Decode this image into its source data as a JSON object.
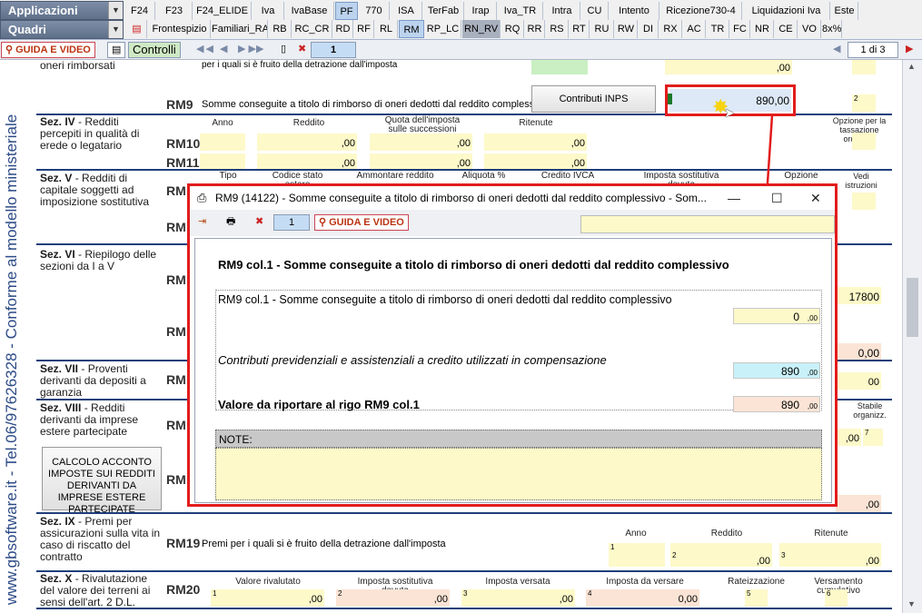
{
  "topbar": {
    "combo1": "Applicazioni",
    "combo2": "Quadri",
    "row1": [
      "F24",
      "F23",
      "F24_ELIDE",
      "Iva",
      "IvaBase",
      "PF",
      "770",
      "ISA",
      "TerFab",
      "Irap",
      "Iva_TR",
      "Intra",
      "CU",
      "Intento",
      "Ricezione730-4",
      "Liquidazioni Iva",
      "Este"
    ],
    "row2": [
      "Frontespizio",
      "Familiari_RA",
      "RB",
      "RC_CR",
      "RD",
      "RF",
      "RL",
      "RM",
      "RP_LC",
      "RN_RV",
      "RQ",
      "RR",
      "RS",
      "RT",
      "RU",
      "RW",
      "DI",
      "RX",
      "AC",
      "TR",
      "FC",
      "NR",
      "CE",
      "VO",
      "8x%"
    ]
  },
  "toolbar": {
    "guida": "GUIDA E VIDEO",
    "controlli": "Controlli",
    "page": "1",
    "pager": "1 di 3"
  },
  "sidebar": {
    "vertical": "www.gbsoftware.it - Tel.06/97626328 - Conforme al modello ministeriale"
  },
  "form": {
    "top_text1": "oneri rimborsati",
    "top_text2": "per i quali si è fruito della detrazione dall'imposta",
    "top_val": ",00",
    "rm9": {
      "label": "RM9",
      "desc": "Somme conseguite a titolo di rimborso di oneri dedotti dal reddito complessivo",
      "button": "Contributi INPS",
      "value": "890",
      "dec": ",00",
      "col2": "2"
    },
    "sez4": {
      "title": "Sez. IV",
      "sub": "- Redditi percepiti in qualità di erede o legatario",
      "h": [
        "Anno",
        "Reddito",
        "Quota dell'imposta sulle successioni",
        "Ritenute",
        "Opzione per la tassazione ordinaria"
      ],
      "rows": [
        "RM10",
        "RM11"
      ]
    },
    "sez5": {
      "title": "Sez. V",
      "sub": "- Redditi di capitale soggetti ad imposizione sostitutiva",
      "h": [
        "Tipo",
        "Codice stato estero",
        "Ammontare reddito",
        "Aliquota %",
        "Credito IVCA",
        "Imposta sostitutiva dovuta",
        "Opzione",
        "Vedi istruzioni"
      ],
      "rows": [
        "RM",
        "RM"
      ]
    },
    "sez6": {
      "title": "Sez. VI",
      "sub": "- Riepilogo delle sezioni da I a V",
      "rows": [
        "RM",
        "RM"
      ],
      "val": "178",
      "val2": "0"
    },
    "sez7": {
      "title": "Sez. VII",
      "sub": "- Proventi derivanti da depositi a garanzia",
      "rows": [
        "RM"
      ]
    },
    "sez8": {
      "title": "Sez. VIII",
      "sub": "- Redditi derivanti da imprese estere partecipate",
      "rows": [
        "RM",
        "RM"
      ],
      "stabile": "Stabile organizz.",
      "btn": "CALCOLO ACCONTO IMPOSTE SUI REDDITI DERIVANTI DA IMPRESE ESTERE PARTECIPATE"
    },
    "sez9": {
      "title": "Sez. IX",
      "sub": "- Premi per assicurazioni sulla vita in caso di riscatto del contratto",
      "row": "RM19",
      "desc": "Premi per i quali si è fruito della detrazione dall'imposta",
      "h": [
        "Anno",
        "Reddito",
        "Ritenute"
      ]
    },
    "sez10": {
      "title": "Sez. X",
      "sub": "- Rivalutazione del valore dei terreni ai sensi dell'art. 2 D.L.",
      "row": "RM20",
      "h": [
        "Valore rivalutato",
        "Imposta sostitutiva dovuta",
        "Imposta versata",
        "Imposta da versare",
        "Rateizzazione",
        "Versamento cumulativo"
      ],
      "v4": "0"
    }
  },
  "dialog": {
    "title": "RM9 (14122) - Somme conseguite a titolo di rimborso di oneri dedotti dal reddito complessivo - Som...",
    "page": "1",
    "guida": "GUIDA E VIDEO",
    "heading": "RM9 col.1 - Somme conseguite a titolo di rimborso di oneri dedotti dal reddito complessivo",
    "line1": "RM9 col.1 - Somme conseguite a titolo di rimborso di oneri dedotti dal reddito complessivo",
    "val1": "0",
    "line2": "Contributi previdenziali e assistenziali a credito utilizzati in compensazione",
    "val2": "890",
    "line3": "Valore da riportare al rigo RM9 col.1",
    "val3": "890",
    "dec": ",00",
    "note": "NOTE:"
  }
}
